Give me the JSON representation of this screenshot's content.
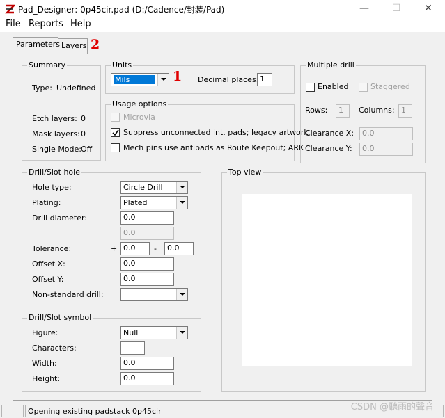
{
  "window": {
    "title": "Pad_Designer: 0p45cir.pad (D:/Cadence/封装/Pad)",
    "minimize_glyph": "—",
    "maximize_glyph": "☐",
    "close_glyph": "✕"
  },
  "menu": [
    "File",
    "Reports",
    "Help"
  ],
  "tabs": [
    {
      "label": "Parameters",
      "active": true
    },
    {
      "label": "Layers",
      "active": false
    }
  ],
  "annotations": {
    "units_marker": "1",
    "tab_marker": "2",
    "marker_color": "#e00000"
  },
  "summary": {
    "legend": "Summary",
    "type_label": "Type:",
    "type_value": "Undefined",
    "etch_label": "Etch layers:",
    "etch_value": "0",
    "mask_label": "Mask layers:",
    "mask_value": "0",
    "single_label": "Single Mode:",
    "single_value": "Off"
  },
  "units": {
    "legend": "Units",
    "selected": "Mils",
    "decimal_label": "Decimal places:",
    "decimal_value": "1"
  },
  "usage": {
    "legend": "Usage options",
    "microvia": {
      "label": "Microvia",
      "checked": false,
      "enabled": false
    },
    "suppress": {
      "label": "Suppress unconnected int. pads; legacy artwork",
      "checked": true,
      "enabled": true
    },
    "mech": {
      "label": "Mech pins use antipads as Route Keepout; ARK",
      "checked": false,
      "enabled": true
    }
  },
  "multiple_drill": {
    "legend": "Multiple drill",
    "enabled_label": "Enabled",
    "staggered_label": "Staggered",
    "rows_label": "Rows:",
    "rows_value": "1",
    "columns_label": "Columns:",
    "columns_value": "1",
    "clearance_x_label": "Clearance X:",
    "clearance_x_value": "0.0",
    "clearance_y_label": "Clearance Y:",
    "clearance_y_value": "0.0"
  },
  "drill_hole": {
    "legend": "Drill/Slot hole",
    "hole_type_label": "Hole type:",
    "hole_type_value": "Circle Drill",
    "plating_label": "Plating:",
    "plating_value": "Plated",
    "diameter_label": "Drill diameter:",
    "diameter_value": "0.0",
    "diameter_value2": "0.0",
    "tolerance_label": "Tolerance:",
    "tolerance_plus": "+",
    "tolerance_plus_value": "0.0",
    "tolerance_minus": "-",
    "tolerance_minus_value": "0.0",
    "offset_x_label": "Offset X:",
    "offset_x_value": "0.0",
    "offset_y_label": "Offset Y:",
    "offset_y_value": "0.0",
    "nonstandard_label": "Non-standard drill:",
    "nonstandard_value": ""
  },
  "drill_symbol": {
    "legend": "Drill/Slot symbol",
    "figure_label": "Figure:",
    "figure_value": "Null",
    "characters_label": "Characters:",
    "characters_value": "",
    "width_label": "Width:",
    "width_value": "0.0",
    "height_label": "Height:",
    "height_value": "0.0"
  },
  "top_view": {
    "legend": "Top view"
  },
  "status": {
    "message": "Opening existing padstack 0p45cir"
  },
  "watermark": "CSDN @聽雨的聲音"
}
